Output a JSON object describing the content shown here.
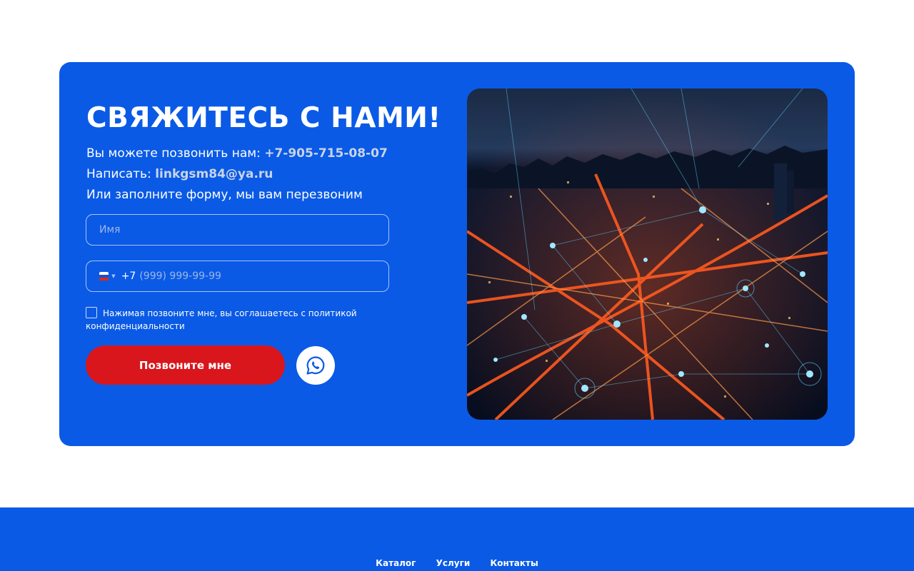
{
  "contact": {
    "title": "СВЯЖИТЕСЬ С НАМИ!",
    "call_prefix": "Вы можете позвонить нам: ",
    "phone": "+7-905-715-08-07",
    "write_prefix": "Написать: ",
    "email": "linkgsm84@ya.ru",
    "form_hint": "Или заполните форму, мы вам перезвоним"
  },
  "form": {
    "name_placeholder": "Имя",
    "phone_code": "+7",
    "phone_placeholder": "(999) 999-99-99",
    "country_flag": "russia-flag",
    "consent_text": "Нажимая позвоните мне, вы соглашаетесь с политикой конфиденциальности",
    "consent_checked": false,
    "submit_label": "Позвоните мне",
    "messenger_icon": "whatsapp-icon"
  },
  "footer": {
    "links": [
      "Каталог",
      "Услуги",
      "Контакты"
    ]
  },
  "colors": {
    "brand_blue": "#0a5ae6",
    "button_red": "#d8161b",
    "link_gray": "#c9d4e6"
  }
}
